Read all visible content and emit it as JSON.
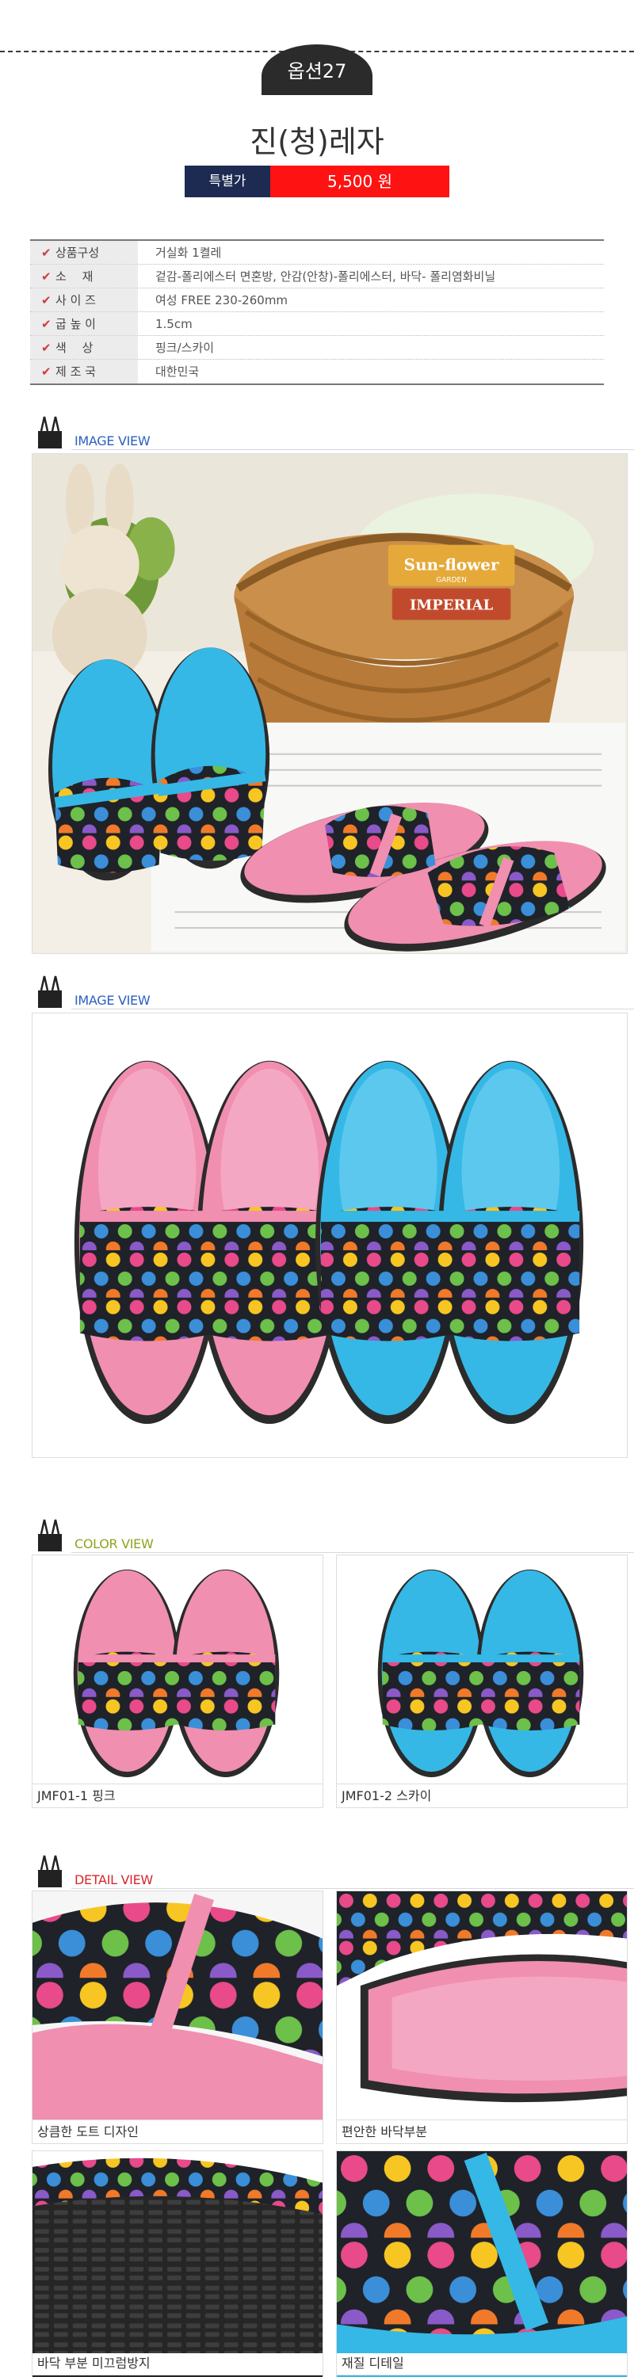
{
  "header": {
    "option_label": "옵션27",
    "product_name": "진(청)레자",
    "price_label": "특별가",
    "price_value": "5,500 원"
  },
  "specs": [
    {
      "key": "상품구성",
      "value": "거실화 1켤레"
    },
    {
      "key": "소　 재",
      "value": "겉감-폴리에스터 면혼방, 안감(안창)-폴리에스터, 바닥- 폴리염화비닐"
    },
    {
      "key": "사 이 즈",
      "value": "여성 FREE 230-260mm"
    },
    {
      "key": "굽 높 이",
      "value": "1.5cm"
    },
    {
      "key": "색　 상",
      "value": "핑크/스카이"
    },
    {
      "key": "제 조 국",
      "value": "대한민국"
    }
  ],
  "sections": {
    "image_view_1": "IMAGE VIEW",
    "image_view_2": "IMAGE VIEW",
    "color_view": "COLOR VIEW",
    "detail_view": "DETAIL VIEW"
  },
  "section_colors": {
    "image_view": "#2a5fbf",
    "color_view": "#8ea31f",
    "detail_view": "#d8262c"
  },
  "photo_text": {
    "sign_top": "Sun-flower",
    "sign_sub": "GARDEN",
    "sign_bottom": "IMPERIAL"
  },
  "color_captions": [
    "JMF01-1 핑크",
    "JMF01-2 스카이"
  ],
  "detail_captions": [
    "상큼한 도트 디자인",
    "편안한 바닥부분",
    "바닥 부분 미끄럼방지",
    "재질 디테일"
  ],
  "colors": {
    "price_label_bg": "#1d2b52",
    "price_value_bg": "#ff1212",
    "pink": "#f08fb0",
    "sky": "#35b8e6"
  }
}
